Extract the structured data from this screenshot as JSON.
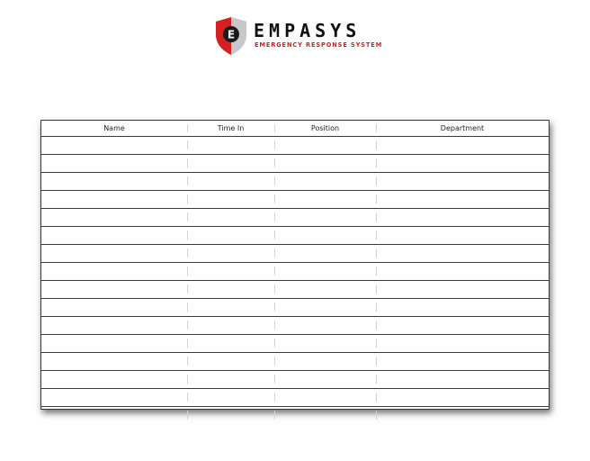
{
  "logo": {
    "brand_text": "EMPASYS",
    "tagline": "EMERGENCY RESPONSE SYSTEM",
    "accent_color": "#d42020",
    "shield_letter": "E"
  },
  "table": {
    "columns": [
      {
        "key": "name",
        "label": "Name"
      },
      {
        "key": "time_in",
        "label": "Time In"
      },
      {
        "key": "position",
        "label": "Position"
      },
      {
        "key": "department",
        "label": "Department"
      }
    ],
    "rows": [
      {
        "name": "",
        "time_in": "",
        "position": "",
        "department": ""
      },
      {
        "name": "",
        "time_in": "",
        "position": "",
        "department": ""
      },
      {
        "name": "",
        "time_in": "",
        "position": "",
        "department": ""
      },
      {
        "name": "",
        "time_in": "",
        "position": "",
        "department": ""
      },
      {
        "name": "",
        "time_in": "",
        "position": "",
        "department": ""
      },
      {
        "name": "",
        "time_in": "",
        "position": "",
        "department": ""
      },
      {
        "name": "",
        "time_in": "",
        "position": "",
        "department": ""
      },
      {
        "name": "",
        "time_in": "",
        "position": "",
        "department": ""
      },
      {
        "name": "",
        "time_in": "",
        "position": "",
        "department": ""
      },
      {
        "name": "",
        "time_in": "",
        "position": "",
        "department": ""
      },
      {
        "name": "",
        "time_in": "",
        "position": "",
        "department": ""
      },
      {
        "name": "",
        "time_in": "",
        "position": "",
        "department": ""
      },
      {
        "name": "",
        "time_in": "",
        "position": "",
        "department": ""
      },
      {
        "name": "",
        "time_in": "",
        "position": "",
        "department": ""
      },
      {
        "name": "",
        "time_in": "",
        "position": "",
        "department": ""
      },
      {
        "name": "",
        "time_in": "",
        "position": "",
        "department": ""
      }
    ]
  }
}
